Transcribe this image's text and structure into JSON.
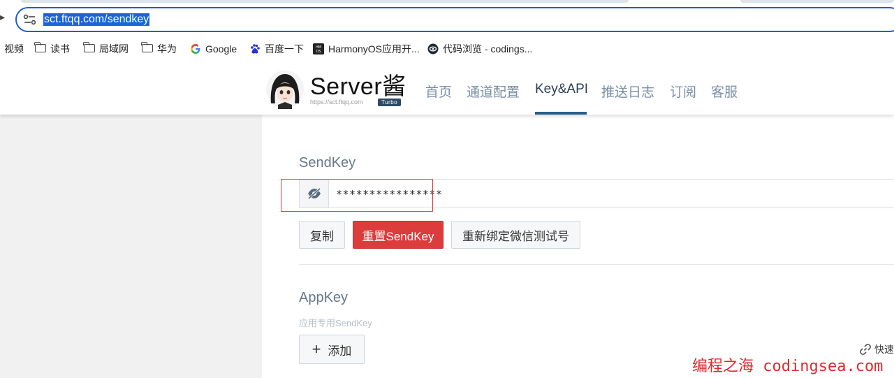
{
  "browser": {
    "url": "sct.ftqq.com/sendkey",
    "bookmarks": [
      {
        "label": "视频",
        "icon": "none"
      },
      {
        "label": "读书",
        "icon": "folder-icon"
      },
      {
        "label": "局域网",
        "icon": "folder-icon"
      },
      {
        "label": "华为",
        "icon": "folder-icon"
      },
      {
        "label": "Google",
        "icon": "google-icon"
      },
      {
        "label": "百度一下",
        "icon": "baidu-icon"
      },
      {
        "label": "HarmonyOS应用开...",
        "icon": "harmonyos-icon"
      },
      {
        "label": "代码浏览 - codings...",
        "icon": "codings-icon"
      }
    ]
  },
  "header": {
    "brand_title": "Server酱",
    "brand_url": "https://sct.ftqq.com",
    "brand_badge": "Turbo",
    "nav": [
      {
        "label": "首页",
        "active": false
      },
      {
        "label": "通道配置",
        "active": false
      },
      {
        "label": "Key&API",
        "active": true
      },
      {
        "label": "推送日志",
        "active": false
      },
      {
        "label": "订阅",
        "active": false
      },
      {
        "label": "客服",
        "active": false
      }
    ],
    "accent_color": "#2d5f86"
  },
  "sendkey": {
    "title": "SendKey",
    "value": "****************",
    "toggle_icon": "eye-slash-icon",
    "buttons": {
      "copy": "复制",
      "reset": "重置SendKey",
      "rebind": "重新绑定微信测试号"
    },
    "highlight_color": "#e0393e"
  },
  "appkey": {
    "title": "AppKey",
    "subtitle": "应用专用SendKey",
    "add_label": "添加"
  },
  "quick_link": "快速",
  "watermark": "编程之海 codingsea.com"
}
